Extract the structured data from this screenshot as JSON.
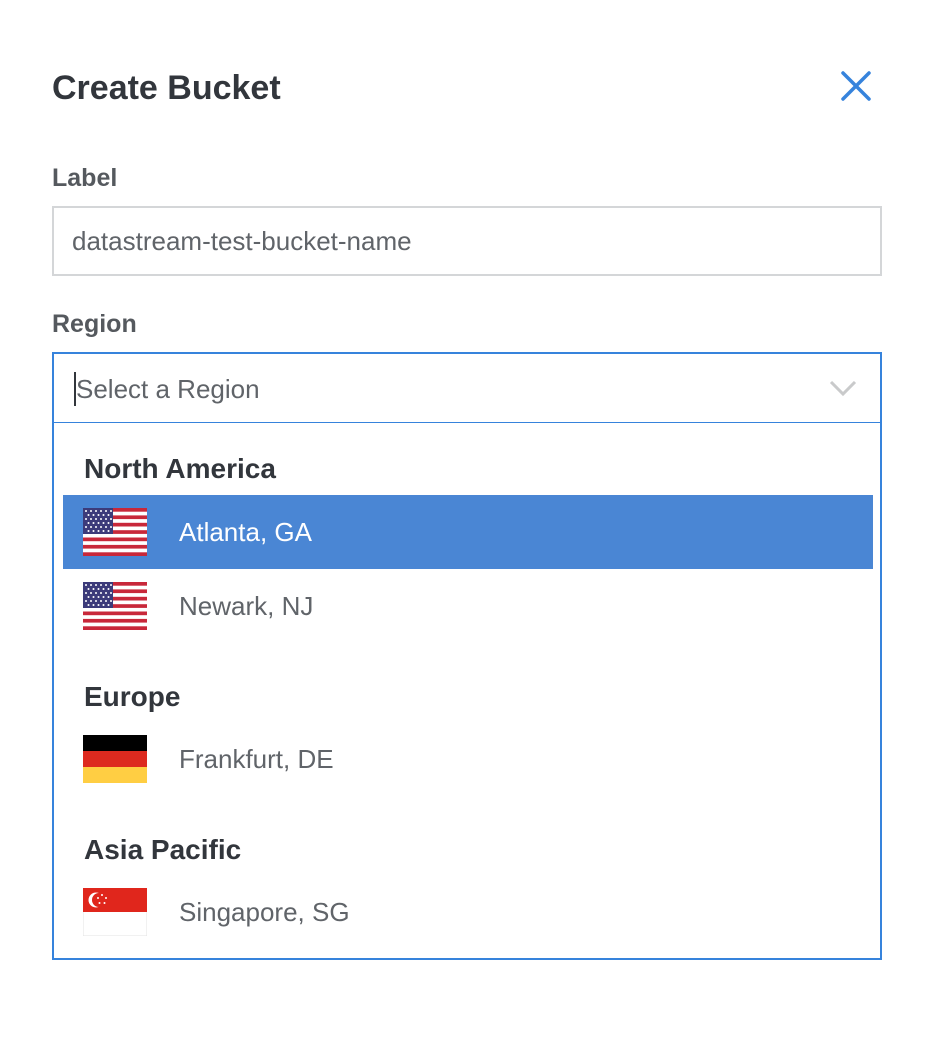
{
  "dialog": {
    "title": "Create Bucket",
    "close_icon": "close-icon",
    "accent_color": "#3683dc"
  },
  "label_field": {
    "label": "Label",
    "placeholder": "datastream-test-bucket-name",
    "value": ""
  },
  "region_field": {
    "label": "Region",
    "placeholder": "Select a Region",
    "chevron_icon": "chevron-down-icon",
    "groups": [
      {
        "heading": "North America",
        "options": [
          {
            "label": "Atlanta, GA",
            "flag_icon": "us-flag-icon",
            "highlighted": true
          },
          {
            "label": "Newark, NJ",
            "flag_icon": "us-flag-icon",
            "highlighted": false
          }
        ]
      },
      {
        "heading": "Europe",
        "options": [
          {
            "label": "Frankfurt, DE",
            "flag_icon": "de-flag-icon",
            "highlighted": false
          }
        ]
      },
      {
        "heading": "Asia Pacific",
        "options": [
          {
            "label": "Singapore, SG",
            "flag_icon": "sg-flag-icon",
            "highlighted": false
          }
        ]
      }
    ],
    "highlight_color": "#4a86d4"
  }
}
